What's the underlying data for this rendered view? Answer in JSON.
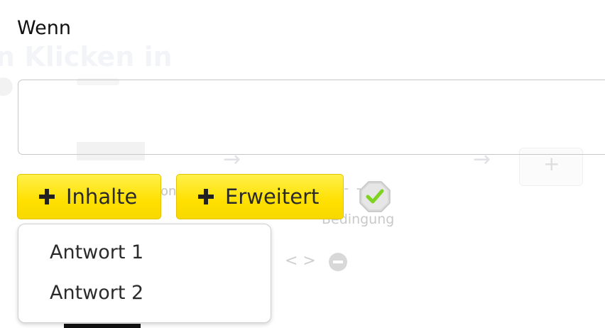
{
  "condition_section": {
    "title": "Wenn",
    "input_value": "",
    "buttons": {
      "add_content_label": "Inhalte",
      "advanced_label": "Erweitert"
    },
    "dropdown": {
      "items": [
        {
          "label": "Antwort 1"
        },
        {
          "label": "Antwort 2"
        }
      ]
    }
  },
  "background": {
    "heading_fragment": "n Klicken in",
    "condition_label": "Bedingung"
  },
  "colors": {
    "button_yellow": "#ffe600",
    "button_border": "#e2c500",
    "check_green": "#7ed321"
  }
}
